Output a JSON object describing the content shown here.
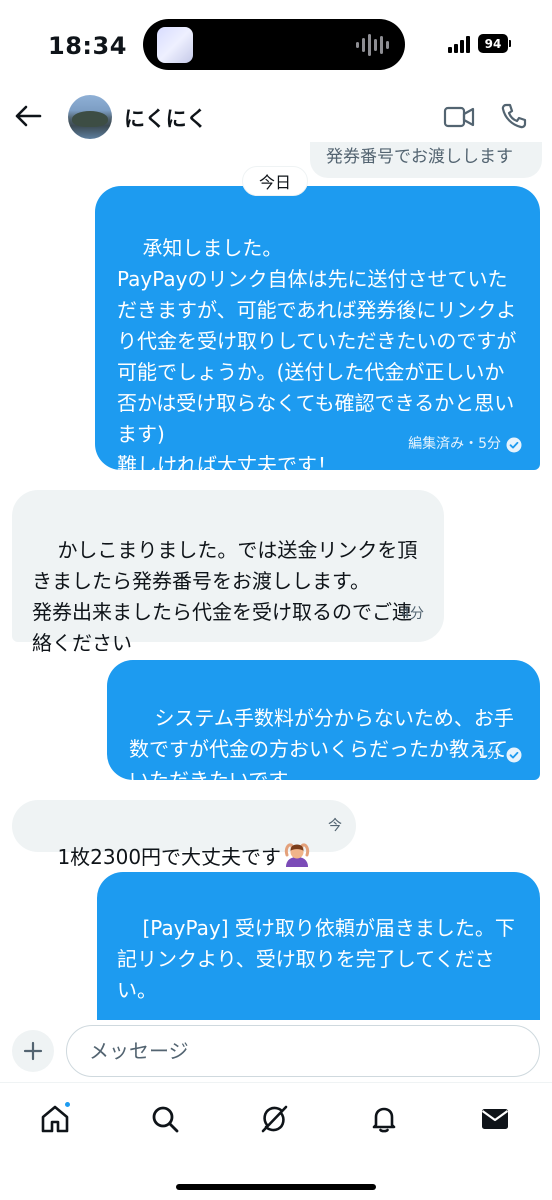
{
  "status_bar": {
    "time": "18:34",
    "battery_level": "94",
    "signal_bars": 4,
    "icons": [
      "signal-icon",
      "battery-icon",
      "audio-wave-icon"
    ]
  },
  "header": {
    "contact_name": "にくにく",
    "icons": [
      "back-arrow-icon",
      "video-call-icon",
      "phone-call-icon"
    ]
  },
  "chat": {
    "previous_message_fragment": "発券番号でお渡しします",
    "date_divider": "今日",
    "messages": [
      {
        "direction": "sent",
        "text": "承知しました。\nPayPayのリンク自体は先に送付させていただきますが、可能であれば発券後にリンクより代金を受け取りしていただきたいのですが可能でしょうか。(送付した代金が正しいか否かは受け取らなくても確認できるかと思います)\n難しければ大丈夫です！",
        "meta": "編集済み・5分",
        "read": true
      },
      {
        "direction": "received",
        "text": "かしこまりました。では送金リンクを頂きましたら発券番号をお渡しします。\n発券出来ましたら代金を受け取るのでご連絡ください",
        "meta": "4分"
      },
      {
        "direction": "sent",
        "text": "システム手数料が分からないため、お手数ですが代金の方おいくらだったか教えていただきたいです。",
        "meta": "1分",
        "read": true
      },
      {
        "direction": "received",
        "text": "1枚2300円で大丈夫です",
        "emoji": "person-gesturing-ok",
        "meta": "今"
      },
      {
        "direction": "sent",
        "text": "[PayPay] 受け取り依頼が届きました。下記リンクより、受け取りを完了してください。"
      }
    ]
  },
  "composer": {
    "placeholder": "メッセージ",
    "icons": [
      "plus-icon"
    ]
  },
  "tabbar": {
    "tabs": [
      {
        "name": "home",
        "icon": "home-icon",
        "has_notification": true
      },
      {
        "name": "search",
        "icon": "search-icon"
      },
      {
        "name": "grok",
        "icon": "grok-icon"
      },
      {
        "name": "notifications",
        "icon": "bell-icon"
      },
      {
        "name": "messages",
        "icon": "mail-icon",
        "active": true
      }
    ]
  },
  "colors": {
    "accent": "#1d9bf0",
    "received_bubble": "#eff3f4",
    "text": "#0f1419",
    "secondary_text": "#536471"
  }
}
